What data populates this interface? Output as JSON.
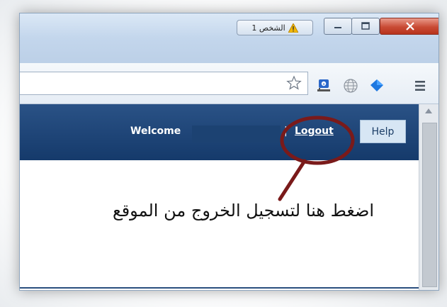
{
  "titlebar": {
    "profile_label": "الشخص 1",
    "minimize_icon": "minimize-icon",
    "maximize_icon": "maximize-icon",
    "close_icon": "close-icon"
  },
  "toolbar": {
    "omnibox_value": "",
    "icons": [
      "star-icon",
      "user-extension-icon",
      "globe-icon",
      "diamond-extension-icon",
      "menu-icon"
    ]
  },
  "site": {
    "welcome_label": "Welcome",
    "separator": "|",
    "logout_label": "Logout",
    "help_label": "Help"
  },
  "annotation": {
    "instruction": "اضغط هنا لتسجيل الخروج من الموقع",
    "highlight_color": "#7a1a1a"
  },
  "colors": {
    "nav_bg": "#153a6b",
    "help_bg": "#d7e6f4",
    "close_button": "#c94b35"
  }
}
